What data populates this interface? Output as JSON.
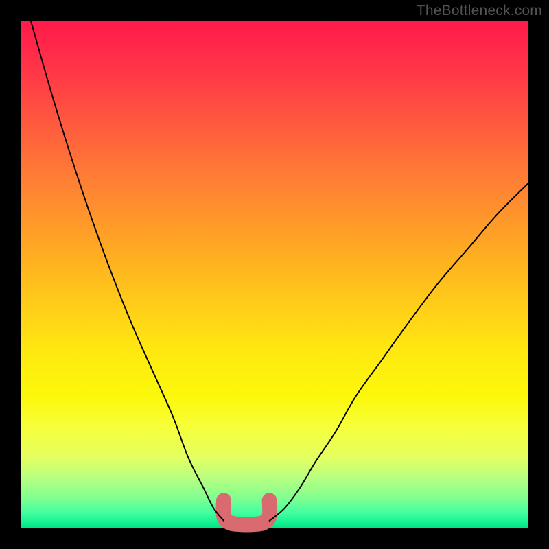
{
  "watermark": "TheBottleneck.com",
  "chart_data": {
    "type": "line",
    "title": "",
    "xlabel": "",
    "ylabel": "",
    "xlim": [
      0,
      100
    ],
    "ylim": [
      0,
      100
    ],
    "series": [
      {
        "name": "left-curve",
        "x": [
          2,
          6,
          10,
          14,
          18,
          22,
          26,
          30,
          33,
          36,
          38,
          40
        ],
        "values": [
          100,
          86,
          73,
          61,
          50,
          40,
          31,
          22,
          14,
          8,
          4,
          1.5
        ]
      },
      {
        "name": "right-curve",
        "x": [
          49,
          52,
          55,
          58,
          62,
          66,
          71,
          76,
          82,
          88,
          94,
          100
        ],
        "values": [
          1.5,
          4,
          8,
          13,
          19,
          26,
          33,
          40,
          48,
          55,
          62,
          68
        ]
      },
      {
        "name": "blob-outline",
        "x": [
          40,
          40,
          41,
          43,
          46,
          48,
          49,
          49
        ],
        "values": [
          5.5,
          2.5,
          1.2,
          0.8,
          0.8,
          1.2,
          2.5,
          5.5
        ]
      }
    ],
    "blob": {
      "color": "#d96a6f",
      "stroke_width_px": 22
    },
    "curve_style": {
      "color": "#000000",
      "stroke_width_px": 2
    }
  }
}
